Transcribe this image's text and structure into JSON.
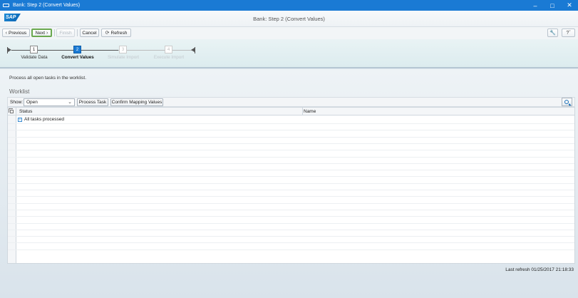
{
  "window": {
    "title": "Bank: Step 2  (Convert Values)",
    "controls": [
      "minimize-icon",
      "maximize-icon",
      "close-icon"
    ]
  },
  "header": {
    "logo": "SAP",
    "title": "Bank: Step 2  (Convert Values)"
  },
  "toolbar": {
    "previous": "Previous",
    "next": "Next",
    "finish": "Finish",
    "cancel": "Cancel",
    "refresh": "Refresh"
  },
  "roadmap": {
    "steps": [
      {
        "number": "1",
        "label": "Validate Data",
        "state": "done"
      },
      {
        "number": "2",
        "label": "Convert Values",
        "state": "active"
      },
      {
        "number": "3",
        "label": "Simulate Import",
        "state": "future"
      },
      {
        "number": "4",
        "label": "Execute Import",
        "state": "future"
      }
    ]
  },
  "content": {
    "instruction": "Process all open tasks in the worklist.",
    "worklist_title": "Worklist",
    "show_label": "Show:",
    "show_value": "Open",
    "process_task": "Process Task",
    "confirm_mapping": "Confirm Mapping Values",
    "columns": [
      "Status",
      "Name"
    ],
    "rows": [
      {
        "status": "All tasks processed",
        "name": ""
      }
    ],
    "last_refresh": "Last refresh 01/25/2017 21:18:33"
  },
  "colors": {
    "titlebar": "#1a7ad4",
    "active_step": "#1a7ad4",
    "focus_border": "#6aa84f"
  }
}
